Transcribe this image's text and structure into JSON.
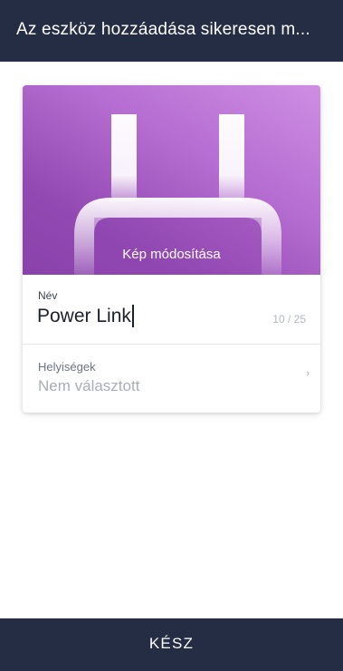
{
  "header": {
    "title": "Az eszköz hozzáadása sikeresen m..."
  },
  "device_image": {
    "edit_label": "Kép módosítása",
    "icon": "plug-icon"
  },
  "form": {
    "name": {
      "label": "Név",
      "value": "Power Link",
      "counter": "10 / 25"
    },
    "rooms": {
      "label": "Helyiségek",
      "value": "Nem választott",
      "chevron": "›"
    }
  },
  "footer": {
    "done_label": "KÉSZ"
  },
  "colors": {
    "bar_background": "#252d45",
    "image_gradient_start": "#cf8ee4",
    "image_gradient_end": "#8a42ab"
  }
}
